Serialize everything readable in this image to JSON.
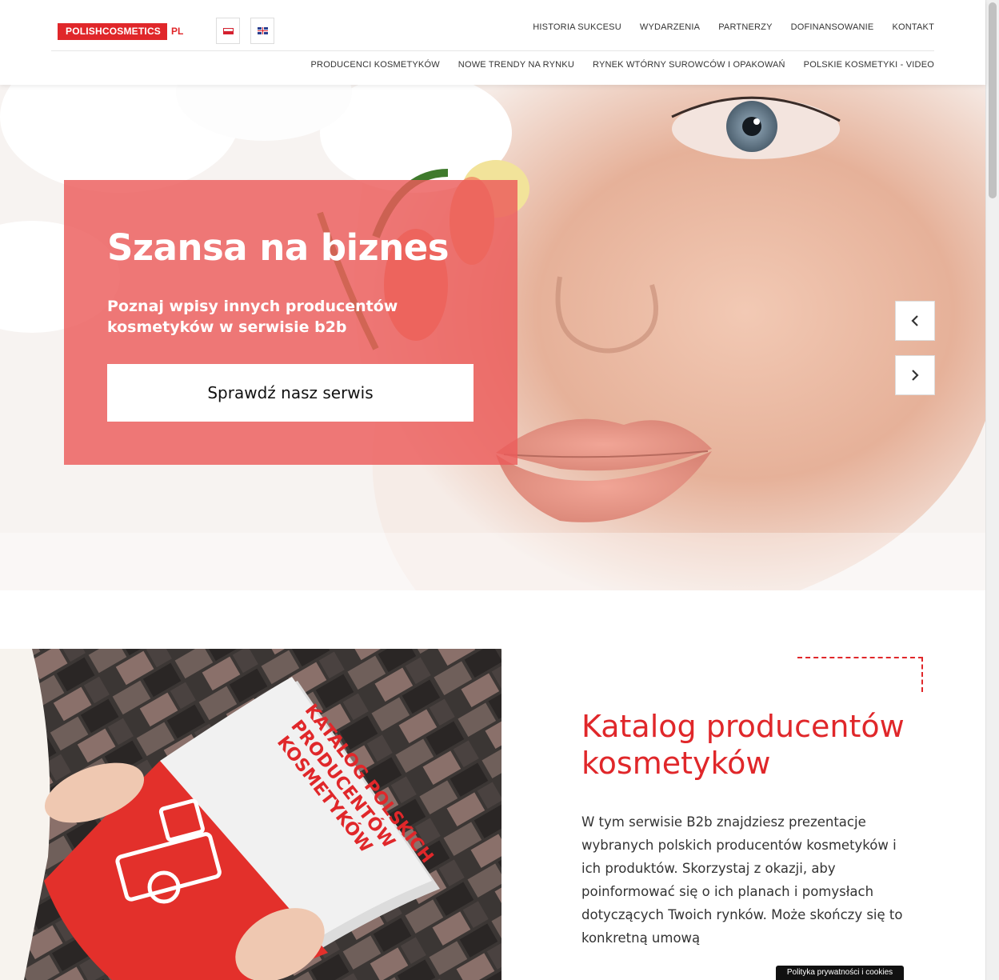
{
  "header": {
    "logo_text": "POLISHCOSMETICS",
    "logo_suffix": "PL",
    "languages": [
      "pl-flag-icon",
      "gb-flag-icon"
    ],
    "nav_top": [
      "HISTORIA SUKCESU",
      "WYDARZENIA",
      "PARTNERZY",
      "DOFINANSOWANIE",
      "KONTAKT"
    ],
    "nav_bottom": [
      "PRODUCENCI KOSMETYKÓW",
      "NOWE TRENDY NA RYNKU",
      "RYNEK WTÓRNY SUROWCÓW I OPAKOWAŃ",
      "POLSKIE KOSMETYKI - VIDEO"
    ]
  },
  "hero": {
    "title": "Szansa na biznes",
    "subtitle": "Poznaj wpisy innych producentów kosmetyków w serwisie b2b",
    "cta_label": "Sprawdź nasz serwis",
    "prev_icon": "chevron-left-icon",
    "next_icon": "chevron-right-icon",
    "panel_color": "#ec5c5a"
  },
  "catalog": {
    "title": "Katalog producentów kosmetyków",
    "text": "W tym serwisie B2b znajdziesz prezentacje wybranych polskich producentów kosmetyków i ich produktów. Skorzystaj z okazji, aby poinformować się o ich planach i pomysłach dotyczących Twoich rynków. Może skończy się to konkretną umową",
    "book_cover_text": [
      "KATALOG POLSKICH",
      "PRODUCENTÓW",
      "KOSMETYKÓW"
    ]
  },
  "cookie": {
    "label": "Polityka prywatności i cookies"
  },
  "colors": {
    "brand_red": "#e0272a",
    "text_dark": "#333333"
  }
}
